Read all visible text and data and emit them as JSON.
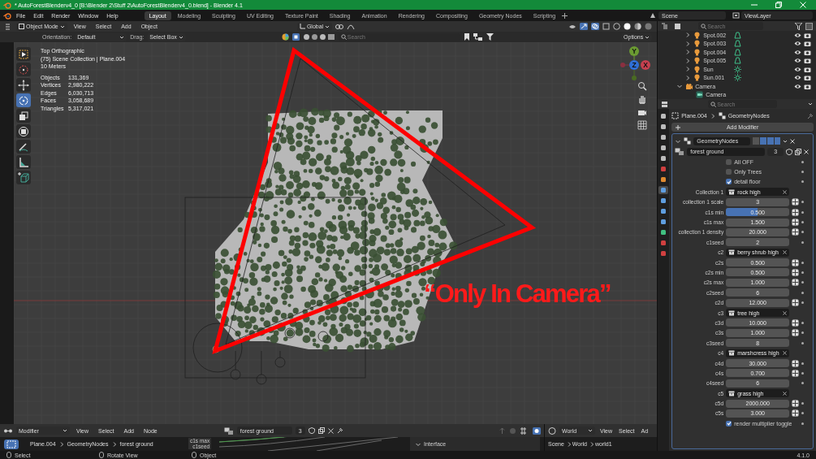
{
  "window": {
    "title": "* AutoForestBlenderv4_0 [B:\\Blender 2\\Stuff 2\\AutoForestBlenderv4_0.blend] - Blender 4.1"
  },
  "menu": [
    "File",
    "Edit",
    "Render",
    "Window",
    "Help"
  ],
  "workspaces": [
    {
      "label": "Layout",
      "selected": true
    },
    {
      "label": "Modeling",
      "selected": false
    },
    {
      "label": "Sculpting",
      "selected": false
    },
    {
      "label": "UV Editing",
      "selected": false
    },
    {
      "label": "Texture Paint",
      "selected": false
    },
    {
      "label": "Shading",
      "selected": false
    },
    {
      "label": "Animation",
      "selected": false
    },
    {
      "label": "Rendering",
      "selected": false
    },
    {
      "label": "Compositing",
      "selected": false
    },
    {
      "label": "Geometry Nodes",
      "selected": false
    },
    {
      "label": "Scripting",
      "selected": false
    }
  ],
  "scene": {
    "name": "Scene"
  },
  "view_layer": {
    "name": "ViewLayer"
  },
  "viewport": {
    "mode": "Object Mode",
    "menus": [
      "View",
      "Select",
      "Add",
      "Object"
    ],
    "transform_orientation": "Global",
    "orientation_label": "Orientation:",
    "orientation": "Default",
    "drag_label": "Drag:",
    "drag": "Select Box",
    "search_placeholder": "Search",
    "options": "Options",
    "overlay_info": [
      "Top Orthographic",
      "(75) Scene Collection | Plane.004",
      "10 Meters"
    ],
    "stats": [
      {
        "label": "Objects",
        "value": "131,369"
      },
      {
        "label": "Vertices",
        "value": "2,980,222"
      },
      {
        "label": "Edges",
        "value": "6,030,713"
      },
      {
        "label": "Faces",
        "value": "3,058,689"
      },
      {
        "label": "Triangles",
        "value": "5,317,021"
      }
    ],
    "tools": [
      {
        "kind": "select",
        "selected": false
      },
      {
        "kind": "cursor",
        "selected": false
      },
      {
        "kind": "move",
        "selected": false
      },
      {
        "kind": "rotate",
        "selected": true
      },
      {
        "kind": "scale",
        "selected": false
      },
      {
        "kind": "transform",
        "selected": false
      },
      {
        "kind": "annotate",
        "selected": false
      },
      {
        "kind": "measure",
        "selected": false
      },
      {
        "kind": "add_cube",
        "selected": false
      }
    ],
    "gizmo_axes": [
      "Y",
      "Z",
      "X"
    ],
    "caption": "“Only In Camera”"
  },
  "outliner": {
    "search_placeholder": "Search",
    "items": [
      {
        "name": "Spot.002",
        "kind": "spot",
        "expanded": false
      },
      {
        "name": "Spot.003",
        "kind": "spot",
        "expanded": false
      },
      {
        "name": "Spot.004",
        "kind": "spot",
        "expanded": false
      },
      {
        "name": "Spot.005",
        "kind": "spot",
        "expanded": false
      },
      {
        "name": "Sun",
        "kind": "sun",
        "expanded": false
      },
      {
        "name": "Sun.001",
        "kind": "sun",
        "expanded": false
      },
      {
        "name": "Camera",
        "kind": "camera",
        "expanded": true,
        "children": [
          {
            "name": "Camera",
            "kind": "camera_data"
          }
        ]
      }
    ]
  },
  "properties": {
    "search_placeholder": "Search",
    "tabs": [
      {
        "kind": "tool",
        "selected": false
      },
      {
        "kind": "render",
        "selected": false
      },
      {
        "kind": "output",
        "selected": false
      },
      {
        "kind": "view_layer",
        "selected": false
      },
      {
        "kind": "scene",
        "selected": false
      },
      {
        "kind": "world",
        "selected": false
      },
      {
        "kind": "object",
        "selected": false
      },
      {
        "kind": "modifiers",
        "selected": true
      },
      {
        "kind": "particles",
        "selected": false
      },
      {
        "kind": "physics",
        "selected": false
      },
      {
        "kind": "constraints",
        "selected": false
      },
      {
        "kind": "data",
        "selected": false
      },
      {
        "kind": "material",
        "selected": false
      },
      {
        "kind": "texture",
        "selected": false
      }
    ],
    "breadcrumb": [
      "Plane.004",
      "GeometryNodes"
    ],
    "add_modifier": "Add Modifier",
    "modifier": {
      "name": "GeometryNodes",
      "expanded": true,
      "node_group": "forest ground",
      "users": "3",
      "inputs": [
        {
          "kind": "checkbox",
          "label": "All OFF",
          "checked": false
        },
        {
          "kind": "checkbox",
          "label": "Only Trees",
          "checked": false
        },
        {
          "kind": "checkbox",
          "label": "detail floor",
          "checked": true
        },
        {
          "kind": "collection",
          "label": "Collection 1",
          "value": "rock high"
        },
        {
          "kind": "float",
          "label": "collection 1 scale",
          "value": "3"
        },
        {
          "kind": "slider",
          "label": "c1s min",
          "value": "0.500",
          "level": 0.5
        },
        {
          "kind": "float",
          "label": "c1s max",
          "value": "1.500"
        },
        {
          "kind": "float",
          "label": "collection 1 density",
          "value": "20.000"
        },
        {
          "kind": "int",
          "label": "c1seed",
          "value": "2"
        },
        {
          "kind": "collection",
          "label": "c2",
          "value": "berry shrub high"
        },
        {
          "kind": "float",
          "label": "c2s",
          "value": "0.500"
        },
        {
          "kind": "float",
          "label": "c2s min",
          "value": "0.500"
        },
        {
          "kind": "float",
          "label": "c2s max",
          "value": "1.000"
        },
        {
          "kind": "int",
          "label": "c2seed",
          "value": "6"
        },
        {
          "kind": "float",
          "label": "c2d",
          "value": "12.000"
        },
        {
          "kind": "collection",
          "label": "c3",
          "value": "tree high"
        },
        {
          "kind": "float",
          "label": "c3d",
          "value": "10.000"
        },
        {
          "kind": "float",
          "label": "c3s",
          "value": "1.000"
        },
        {
          "kind": "int",
          "label": "c3seed",
          "value": "8"
        },
        {
          "kind": "collection",
          "label": "c4",
          "value": "marshcress high"
        },
        {
          "kind": "float",
          "label": "c4d",
          "value": "30.000"
        },
        {
          "kind": "float",
          "label": "c4s",
          "value": "0.700"
        },
        {
          "kind": "int",
          "label": "c4seed",
          "value": "6"
        },
        {
          "kind": "collection",
          "label": "c5",
          "value": "grass high"
        },
        {
          "kind": "float",
          "label": "c5d",
          "value": "2000.000"
        },
        {
          "kind": "float",
          "label": "c5s",
          "value": "3.000"
        },
        {
          "kind": "checkbox",
          "label": "render multiplier toggle",
          "checked": true
        }
      ]
    }
  },
  "node_editor": {
    "editor": "Modifier",
    "menus": [
      "View",
      "Select",
      "Add",
      "Node"
    ],
    "node_group": "forest ground",
    "users": "3",
    "socket_labels": [
      "c1s max",
      "c1seed"
    ],
    "breadcrumb": [
      "Plane.004",
      "GeometryNodes",
      "forest ground"
    ],
    "sidebar_panel": "Interface"
  },
  "world_editor": {
    "world": "World",
    "menus": [
      "View",
      "Select",
      "Ad"
    ],
    "breadcrumb": [
      "Scene",
      "World",
      "world1"
    ]
  },
  "status_bar": {
    "items": [
      "Select",
      "Rotate View",
      "Object"
    ],
    "version": "4.1.0"
  }
}
